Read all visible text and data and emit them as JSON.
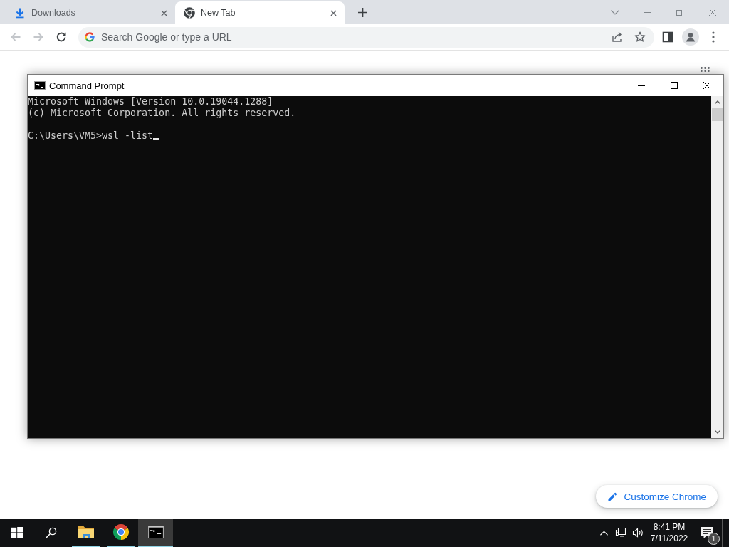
{
  "browser": {
    "tabs": [
      {
        "kind": "downloads",
        "title": "Downloads",
        "selected": false
      },
      {
        "kind": "page",
        "title": "New Tab",
        "selected": true
      }
    ],
    "nav": {
      "back_disabled": true,
      "forward_disabled": true
    },
    "omnibox": {
      "placeholder": "Search Google or type a URL"
    }
  },
  "new_tab_page": {
    "customize_button": "Customize Chrome"
  },
  "console_window": {
    "title": "Command Prompt",
    "output": [
      "Microsoft Windows [Version 10.0.19044.1288]",
      "(c) Microsoft Corporation. All rights reserved."
    ],
    "input_line": "C:\\Users\\VM5>wsl -list"
  },
  "taskbar": {
    "apps": [
      {
        "kind": "file-explorer",
        "running": true,
        "selected": false
      },
      {
        "kind": "chrome",
        "running": true,
        "selected": false
      },
      {
        "kind": "command-prompt",
        "running": true,
        "selected": true
      }
    ],
    "clock": {
      "time": "8:41 PM",
      "date": "7/11/2022"
    },
    "notification_count": "1"
  }
}
